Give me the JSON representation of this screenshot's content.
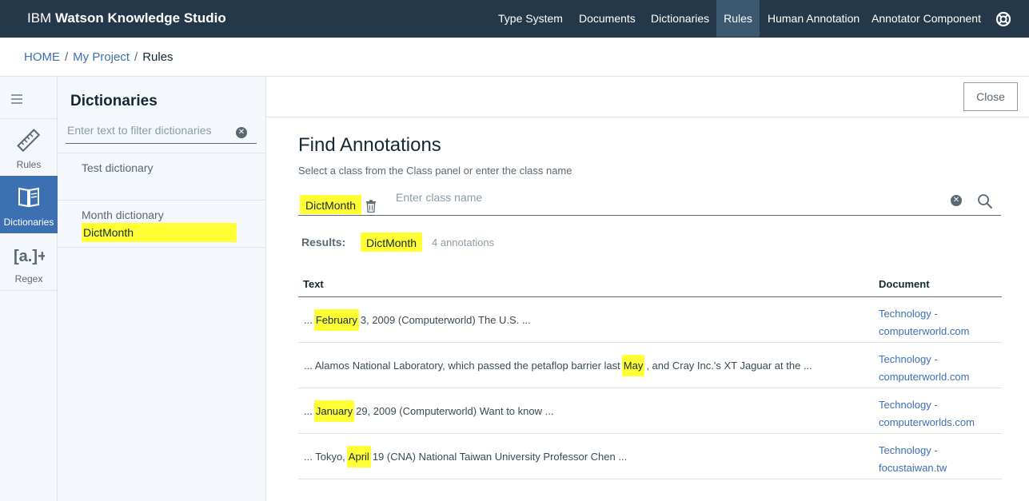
{
  "app": {
    "brand_prefix": "IBM",
    "brand_name": "Watson Knowledge Studio"
  },
  "nav": {
    "items": [
      {
        "label": "Type System"
      },
      {
        "label": "Documents"
      },
      {
        "label": "Dictionaries"
      },
      {
        "label": "Rules",
        "active": true
      },
      {
        "label": "Human Annotation"
      },
      {
        "label": "Annotator Component"
      }
    ],
    "help_icon": "lifebuoy-icon"
  },
  "breadcrumb": {
    "home": "HOME",
    "sep": "/",
    "project": "My Project",
    "current": "Rules"
  },
  "rail": {
    "items": [
      {
        "label": "Rules",
        "icon": "ruler-pencil-icon"
      },
      {
        "label": "Dictionaries",
        "icon": "book-icon",
        "active": true
      },
      {
        "label": "Regex",
        "icon": "regex-icon"
      }
    ]
  },
  "dictionaries": {
    "title": "Dictionaries",
    "filter_placeholder": "Enter text to filter dictionaries",
    "items": [
      {
        "name": "Test dictionary",
        "class": ""
      },
      {
        "name": "Month dictionary",
        "class": "DictMonth"
      }
    ]
  },
  "main": {
    "close_label": "Close",
    "title": "Find Annotations",
    "subtitle": "Select a class from the Class panel or enter the class name",
    "selected_class": "DictMonth",
    "class_placeholder": "Enter class name",
    "results_label": "Results:",
    "results_class": "DictMonth",
    "results_count": "4 annotations",
    "columns": {
      "text": "Text",
      "document": "Document"
    },
    "rows": [
      {
        "pre": "... ",
        "hit": "February",
        "post": " 3, 2009 (Computerworld) The U.S. ...",
        "doc1": "Technology -",
        "doc2": "computerworld.com"
      },
      {
        "pre": "... Alamos National Laboratory, which passed the petaflop barrier last ",
        "hit": "May",
        "post": ", and Cray Inc.'s XT Jaguar at the ...",
        "doc1": "Technology -",
        "doc2": "computerworld.com"
      },
      {
        "pre": "... ",
        "hit": "January",
        "post": " 29, 2009 (Computerworld) Want to know ...",
        "doc1": "Technology -",
        "doc2": "computerworlds.com"
      },
      {
        "pre": "... Tokyo, ",
        "hit": "April",
        "post": " 19 (CNA) National Taiwan University Professor Chen ...",
        "doc1": "Technology -",
        "doc2": "focustaiwan.tw"
      }
    ]
  },
  "colors": {
    "topbar": "#253849",
    "active_nav": "#3c5870",
    "accent": "#3d70b2",
    "highlight": "#ffff33"
  }
}
